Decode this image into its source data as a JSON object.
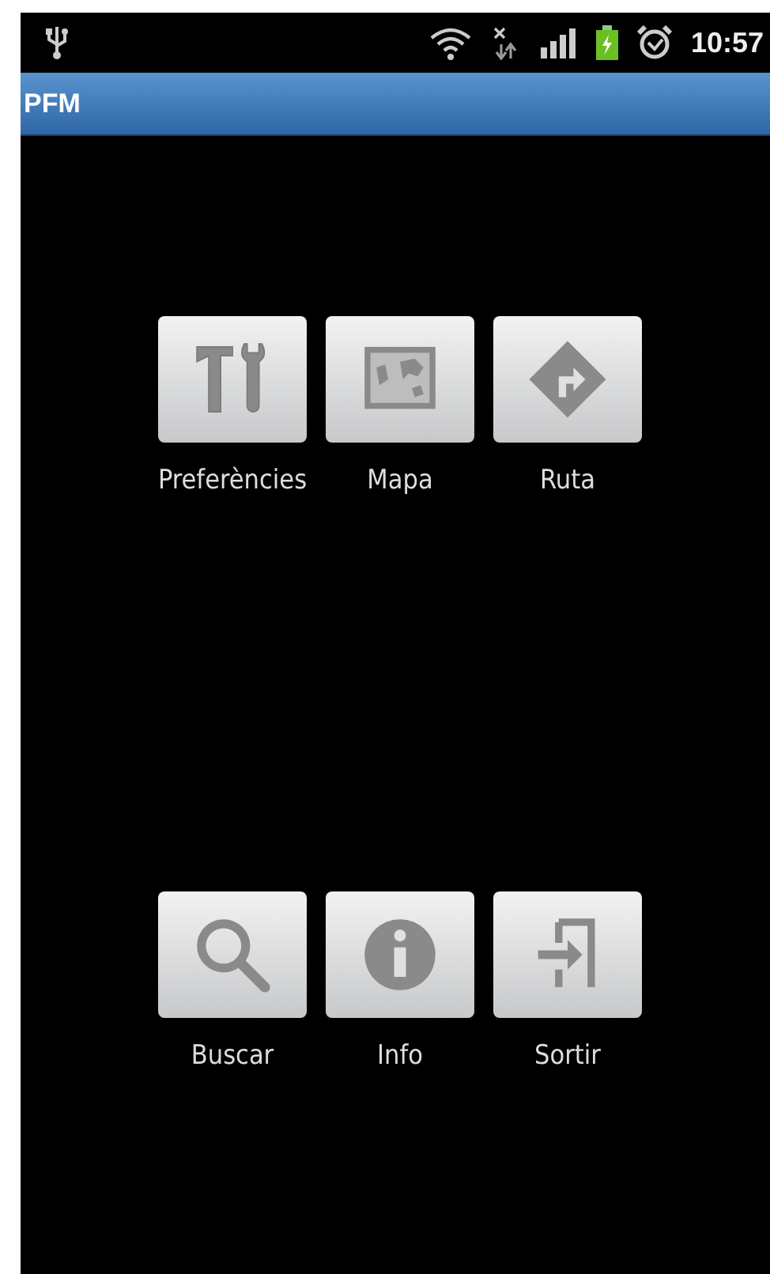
{
  "status_bar": {
    "time": "10:57"
  },
  "title_bar": {
    "title": "PFM"
  },
  "menu_rows": [
    [
      {
        "label": "Preferències"
      },
      {
        "label": "Mapa"
      },
      {
        "label": "Ruta"
      }
    ],
    [
      {
        "label": "Buscar"
      },
      {
        "label": "Info"
      },
      {
        "label": "Sortir"
      }
    ]
  ]
}
